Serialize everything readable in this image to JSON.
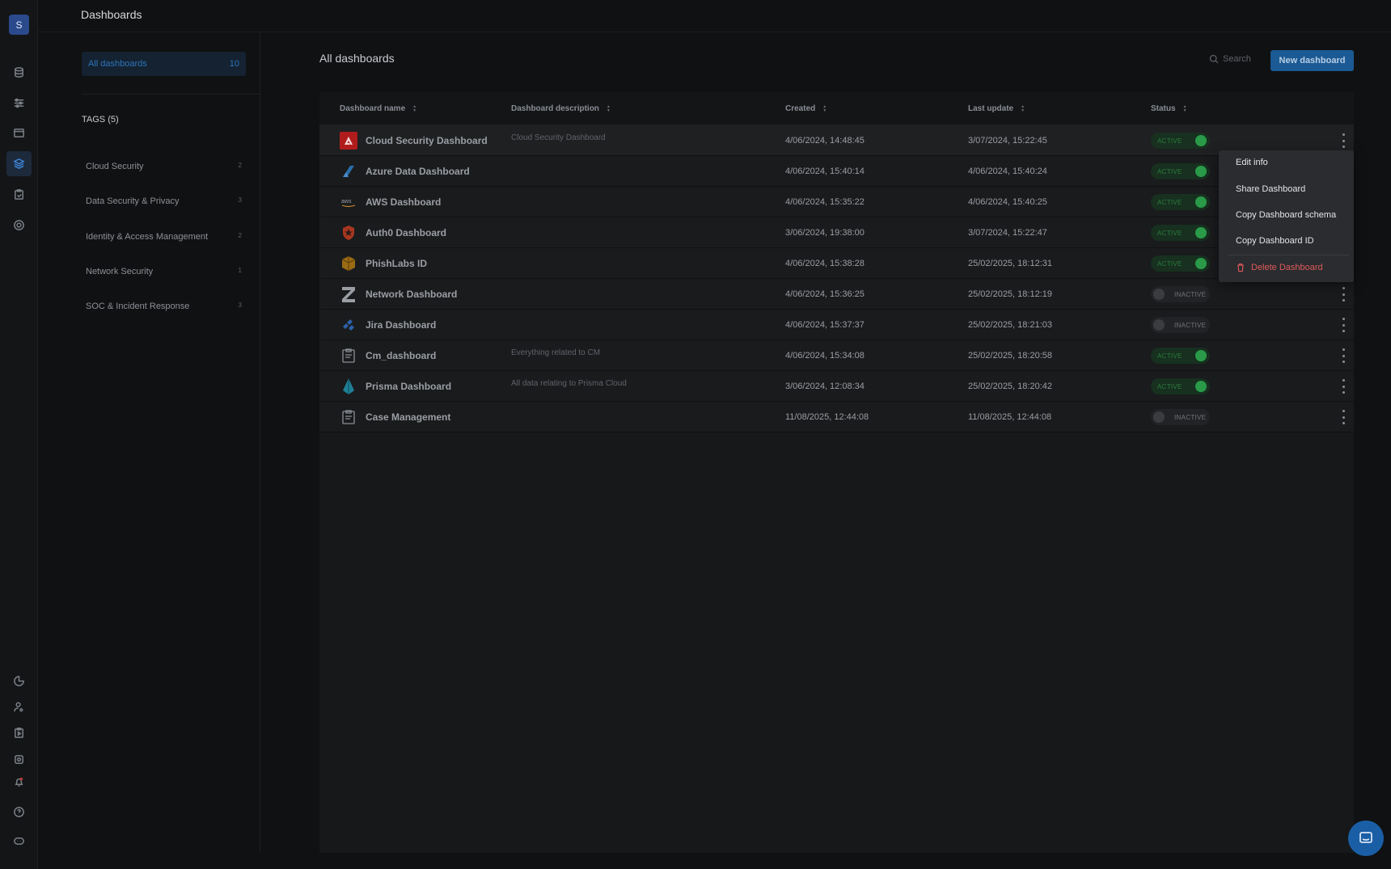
{
  "user": {
    "initial": "S"
  },
  "topbar": {
    "title": "Dashboards"
  },
  "sidebar": {
    "all_label": "All dashboards",
    "all_count": "10",
    "tags_title": "TAGS (5)",
    "tags": [
      {
        "label": "Cloud Security",
        "count": "2"
      },
      {
        "label": "Data Security & Privacy",
        "count": "3"
      },
      {
        "label": "Identity & Access Management",
        "count": "2"
      },
      {
        "label": "Network Security",
        "count": "1"
      },
      {
        "label": "SOC & Incident Response",
        "count": "3"
      }
    ]
  },
  "main": {
    "title": "All dashboards",
    "search_placeholder": "Search",
    "new_button": "New dashboard"
  },
  "table": {
    "columns": [
      "Dashboard name",
      "Dashboard description",
      "Created",
      "Last update",
      "Status"
    ],
    "rows": [
      {
        "name": "Cloud Security Dashboard",
        "description": "Cloud Security Dashboard",
        "created": "4/06/2024, 14:48:45",
        "updated": "3/07/2024, 15:22:45",
        "status": "ACTIVE",
        "icon": "adobe-logo-icon"
      },
      {
        "name": "Azure Data Dashboard",
        "description": "",
        "created": "4/06/2024, 15:40:14",
        "updated": "4/06/2024, 15:40:24",
        "status": "ACTIVE",
        "icon": "azure-logo-icon"
      },
      {
        "name": "AWS Dashboard",
        "description": "",
        "created": "4/06/2024, 15:35:22",
        "updated": "4/06/2024, 15:40:25",
        "status": "ACTIVE",
        "icon": "aws-logo-icon"
      },
      {
        "name": "Auth0 Dashboard",
        "description": "",
        "created": "3/06/2024, 19:38:00",
        "updated": "3/07/2024, 15:22:47",
        "status": "ACTIVE",
        "icon": "auth0-logo-icon"
      },
      {
        "name": "PhishLabs ID",
        "description": "",
        "created": "4/06/2024, 15:38:28",
        "updated": "25/02/2025, 18:12:31",
        "status": "ACTIVE",
        "icon": "phishlabs-logo-icon"
      },
      {
        "name": "Network Dashboard",
        "description": "",
        "created": "4/06/2024, 15:36:25",
        "updated": "25/02/2025, 18:12:19",
        "status": "INACTIVE",
        "icon": "zscaler-logo-icon"
      },
      {
        "name": "Jira Dashboard",
        "description": "",
        "created": "4/06/2024, 15:37:37",
        "updated": "25/02/2025, 18:21:03",
        "status": "INACTIVE",
        "icon": "jira-logo-icon"
      },
      {
        "name": "Cm_dashboard",
        "description": "Everything related to CM",
        "created": "4/06/2024, 15:34:08",
        "updated": "25/02/2025, 18:20:58",
        "status": "ACTIVE",
        "icon": "clipboard-icon"
      },
      {
        "name": "Prisma Dashboard",
        "description": "All data relating to Prisma Cloud",
        "created": "3/06/2024, 12:08:34",
        "updated": "25/02/2025, 18:20:42",
        "status": "ACTIVE",
        "icon": "prisma-logo-icon"
      },
      {
        "name": "Case Management",
        "description": "",
        "created": "11/08/2025, 12:44:08",
        "updated": "11/08/2025, 12:44:08",
        "status": "INACTIVE",
        "icon": "clipboard-icon"
      }
    ]
  },
  "context_menu": {
    "items": [
      "Edit info",
      "Share Dashboard",
      "Copy Dashboard schema",
      "Copy Dashboard ID"
    ],
    "delete": "Delete Dashboard"
  },
  "colors": {
    "accent": "#1b5a94",
    "active": "#2a9a49",
    "danger": "#e05a5a"
  }
}
